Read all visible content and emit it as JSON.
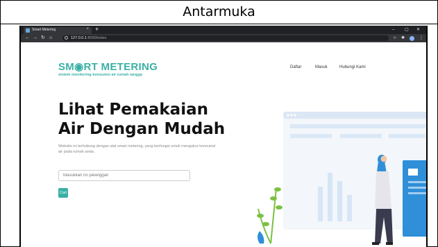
{
  "caption": "Antarmuka",
  "browser": {
    "tab_title": "Smart Metering",
    "tab_close": "×",
    "new_tab": "+",
    "url_host": "127.0.0.1",
    "url_path": ":8000/index",
    "window_controls": [
      "–",
      "▢",
      "✕"
    ],
    "profile": "M"
  },
  "site": {
    "logo": "SM◉RT METERING",
    "tagline": "sistem monitoring konsumsi air rumah tangga",
    "nav": [
      "Daftar",
      "Masuk",
      "Hubungi Kami"
    ]
  },
  "hero": {
    "line1": "Lihat Pemakaian",
    "line2": "Air Dengan Mudah",
    "description": "Website ini terhubung dengan alat smart metering, yang berfungsi untuk mengukur konsumsi air pada rumah anda.",
    "search_placeholder": "Masukkan no pelanggan",
    "button": "Cari"
  },
  "colors": {
    "brand": "#3ab0a5",
    "chrome_dark": "#202124",
    "illustration_blue": "#2f8fd8"
  }
}
